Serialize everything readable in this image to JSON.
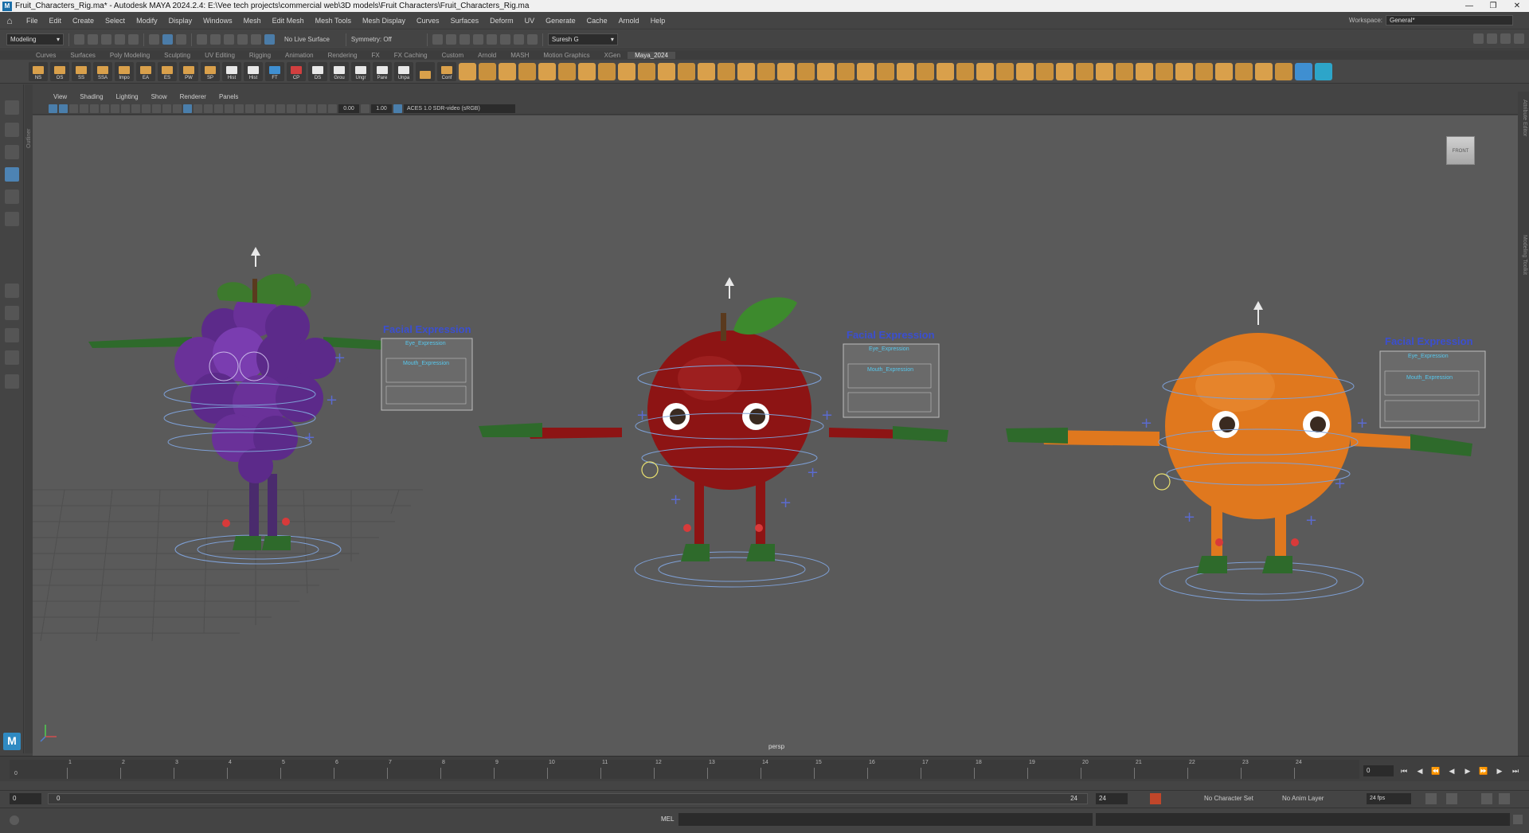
{
  "window": {
    "title": "Fruit_Characters_Rig.ma* - Autodesk MAYA 2024.2.4: E:\\Vee tech projects\\commercial web\\3D models\\Fruit Characters\\Fruit_Characters_Rig.ma"
  },
  "menu": [
    "File",
    "Edit",
    "Create",
    "Select",
    "Modify",
    "Display",
    "Windows",
    "Mesh",
    "Edit Mesh",
    "Mesh Tools",
    "Mesh Display",
    "Curves",
    "Surfaces",
    "Deform",
    "UV",
    "Generate",
    "Cache",
    "Arnold",
    "Help"
  ],
  "workspace": {
    "label": "Workspace:",
    "value": "General*"
  },
  "status": {
    "mode": "Modeling",
    "live_surface": "No Live Surface",
    "symmetry": "Symmetry: Off",
    "user": "Suresh G"
  },
  "shelf_tabs": [
    "Curves",
    "Surfaces",
    "Poly Modeling",
    "Sculpting",
    "UV Editing",
    "Rigging",
    "Animation",
    "Rendering",
    "FX",
    "FX Caching",
    "Custom",
    "Arnold",
    "MASH",
    "Motion Graphics",
    "XGen",
    "Maya_2024"
  ],
  "shelf_buttons": [
    "NS",
    "OS",
    "SS",
    "SSA",
    "Impo",
    "EA",
    "ES",
    "PW",
    "SP",
    "Hist",
    "Hist",
    "FT",
    "CP",
    "DS",
    "Grou",
    "Ungr",
    "Pare",
    "Unpa",
    "Conf"
  ],
  "panel_menu": [
    "View",
    "Shading",
    "Lighting",
    "Show",
    "Renderer",
    "Panels"
  ],
  "panel_toolbar": {
    "exposure": "0.00",
    "gamma": "1.00",
    "color_space": "ACES 1.0 SDR-video (sRGB)"
  },
  "viewport": {
    "camera_label": "persp",
    "view_cube": "FRONT",
    "boards": [
      {
        "title": "Facial Expression",
        "eye": "Eye_Expression",
        "mouth": "Mouth_Expression"
      },
      {
        "title": "Facial Expression",
        "eye": "Eye_Expression",
        "mouth": "Mouth_Expression"
      },
      {
        "title": "Facial Expression",
        "eye": "Eye_Expression",
        "mouth": "Mouth_Expression"
      }
    ],
    "colors": {
      "grape": "#5c2a8a",
      "apple": "#8d1414",
      "orange": "#e0781e",
      "glove": "#2e6a2b",
      "rig_blue": "#7ea0d6",
      "rig_red": "#d83a3a",
      "board_title": "#3b4fd0"
    }
  },
  "outliner_label": "Outliner",
  "right_strip": {
    "top": "Attribute Editor",
    "bottom": "Modeling Toolkit"
  },
  "timeline": {
    "ticks": [
      "1",
      "2",
      "3",
      "4",
      "5",
      "6",
      "7",
      "8",
      "9",
      "10",
      "11",
      "12",
      "13",
      "14",
      "15",
      "16",
      "17",
      "18",
      "19",
      "20",
      "21",
      "22",
      "23",
      "24"
    ],
    "current_frame": "0",
    "start_marker": "0"
  },
  "range": {
    "start": "0",
    "inner_start": "0",
    "inner_end": "24",
    "end": "24",
    "char_set": "No Character Set",
    "anim_layer": "No Anim Layer",
    "fps": "24 fps"
  },
  "cmd": {
    "lang": "MEL"
  }
}
